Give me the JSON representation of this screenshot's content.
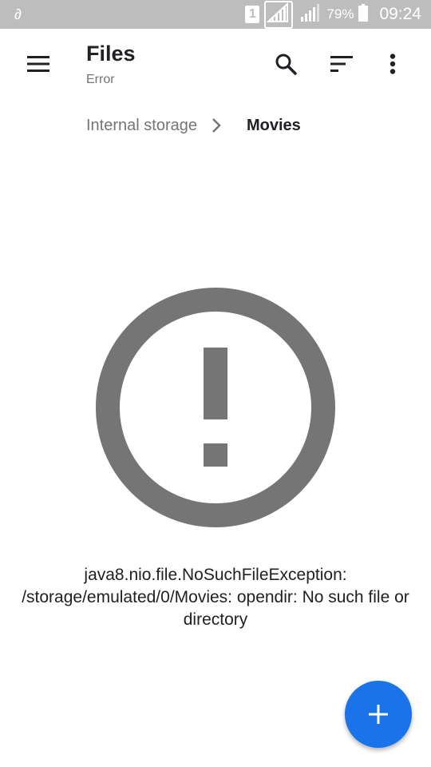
{
  "status_bar": {
    "sim_slot": "1",
    "battery_percent": "79%",
    "time": "09:24",
    "notification_icon": "drop-icon"
  },
  "app_bar": {
    "title": "Files",
    "subtitle": "Error",
    "icons": [
      "menu-icon",
      "search-icon",
      "sort-icon",
      "more-vert-icon"
    ]
  },
  "breadcrumb": {
    "parent": "Internal storage",
    "current": "Movies"
  },
  "error": {
    "icon": "alert-circle-icon",
    "message": "java8.nio.file.NoSuchFileException: /storage/emulated/0/Movies: opendir: No such file or directory"
  },
  "fab": {
    "icon": "plus-icon",
    "color": "#1a73e8"
  },
  "colors": {
    "status_bar": "#bdbdbd",
    "icon_gray": "#757575",
    "accent": "#1a73e8"
  }
}
